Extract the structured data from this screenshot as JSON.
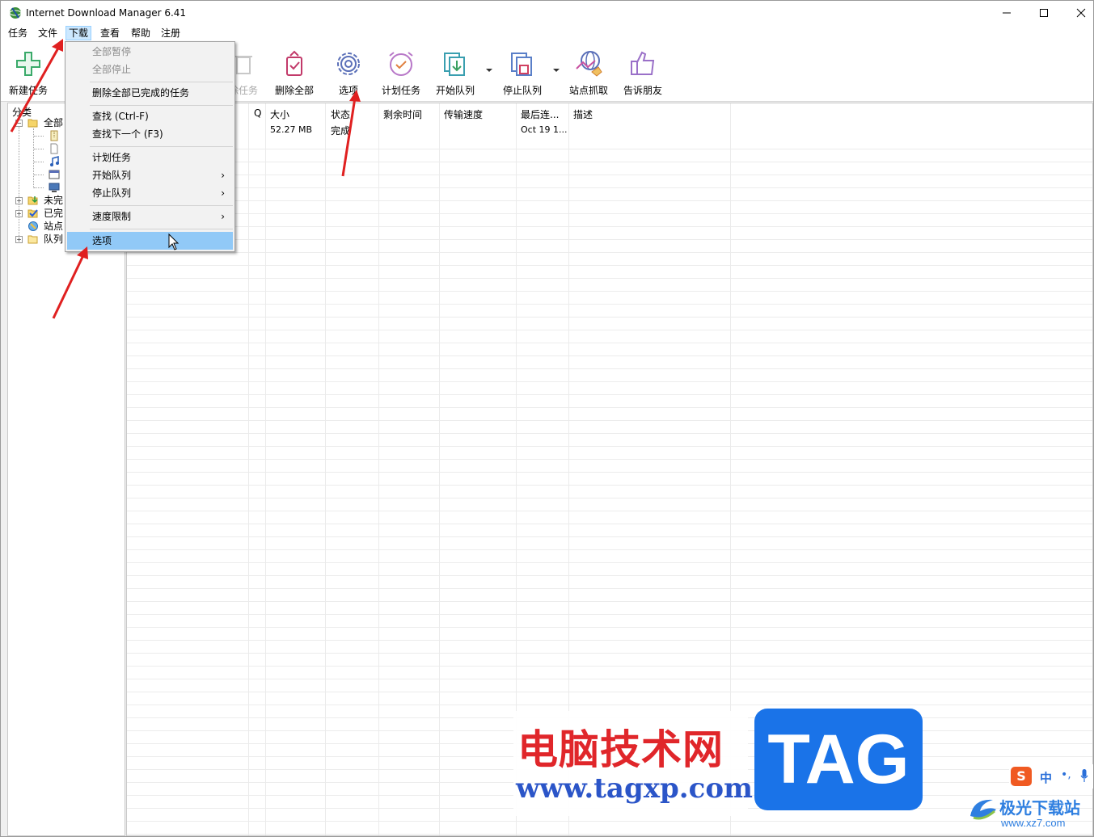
{
  "window": {
    "title": "Internet Download Manager 6.41"
  },
  "menubar": {
    "items": [
      "任务",
      "文件",
      "下载",
      "查看",
      "帮助",
      "注册"
    ],
    "active": "下载"
  },
  "toolbar": {
    "new_task": "新建任务",
    "delete_task": "除任务",
    "delete_all": "删除全部",
    "options": "选项",
    "scheduler": "计划任务",
    "start_queue": "开始队列",
    "stop_queue": "停止队列",
    "site_grabber": "站点抓取",
    "tell_friend": "告诉朋友"
  },
  "left_panel": {
    "title": "分类",
    "tree": {
      "all": "全部",
      "sub": [
        "压",
        "文",
        "音",
        "程",
        "视"
      ],
      "unfinished": "未完",
      "finished": "已完",
      "site": "站点",
      "queue": "队列"
    }
  },
  "list": {
    "headers": [
      "Q",
      "大小",
      "状态",
      "剩余时间",
      "传输速度",
      "最后连...",
      "描述"
    ],
    "row": {
      "size": "52.27 MB",
      "status": "完成",
      "last": "Oct 19 1..."
    }
  },
  "dropdown": {
    "pause_all": "全部暂停",
    "stop_all": "全部停止",
    "delete_completed": "删除全部已完成的任务",
    "find": "查找 (Ctrl-F)",
    "find_next": "查找下一个 (F3)",
    "scheduler": "计划任务",
    "start_queue": "开始队列",
    "stop_queue": "停止队列",
    "speed_limit": "速度限制",
    "options": "选项",
    "submenu_arrow": "›"
  },
  "watermark": {
    "cn": "电脑技术网",
    "url": "www.tagxp.com",
    "tag": "TAG",
    "ime_s": "S",
    "ime_zh": "中",
    "ime_dot": "•,",
    "xz_cn": "极光下载站",
    "xz_url": "www.xz7.com"
  },
  "colors": {
    "accent": "#0078d7",
    "menu_hover": "#91c9f7",
    "arrow_red": "#e02020",
    "wm_red": "#e0262a",
    "wm_blue": "#1a73e8"
  }
}
